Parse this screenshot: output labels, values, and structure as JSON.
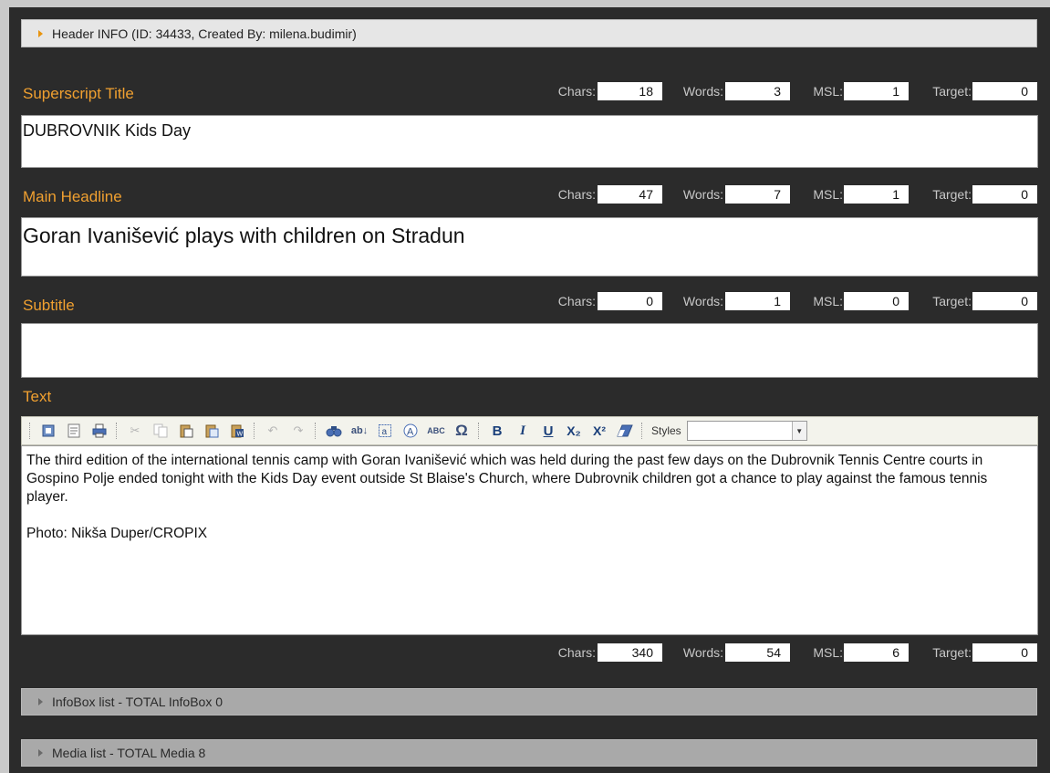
{
  "header_info": {
    "label": "Header INFO (ID: 34433, Created By: milena.budimir)"
  },
  "stat_labels": {
    "chars": "Chars:",
    "words": "Words:",
    "msl": "MSL:",
    "target": "Target:"
  },
  "superscript": {
    "label": "Superscript Title",
    "value": "DUBROVNIK Kids Day",
    "stats": {
      "chars": "18",
      "words": "3",
      "msl": "1",
      "target": "0"
    }
  },
  "headline": {
    "label": "Main Headline",
    "value": "Goran Ivanišević plays with children on Stradun",
    "stats": {
      "chars": "47",
      "words": "7",
      "msl": "1",
      "target": "0"
    }
  },
  "subtitle": {
    "label": "Subtitle",
    "value": "",
    "stats": {
      "chars": "0",
      "words": "1",
      "msl": "0",
      "target": "0"
    }
  },
  "text": {
    "label": "Text",
    "paragraph1": "The third edition of the international tennis camp with Goran Ivanišević which was held during the past few days on the Dubrovnik Tennis Centre courts in Gospino Polje ended tonight with the Kids Day event outside St Blaise's Church, where Dubrovnik children got a chance to play against the famous tennis player.",
    "paragraph2": "Photo: Nikša Duper/CROPIX",
    "stats": {
      "chars": "340",
      "words": "54",
      "msl": "6",
      "target": "0"
    }
  },
  "toolbar": {
    "styles_label": "Styles",
    "styles_value": "",
    "buttons": {
      "bold": "B",
      "italic": "I",
      "underline": "U",
      "subscript": "X₂",
      "superscript": "X²",
      "omega": "Ω",
      "abc": "ABC"
    }
  },
  "infobox_list": {
    "label": "InfoBox list - TOTAL InfoBox 0"
  },
  "media_list": {
    "label": "Media list - TOTAL Media 8"
  },
  "colors": {
    "label_accent": "#f0a030",
    "panel_bg": "#2b2b2b",
    "arrow_accent": "#e8940f"
  }
}
